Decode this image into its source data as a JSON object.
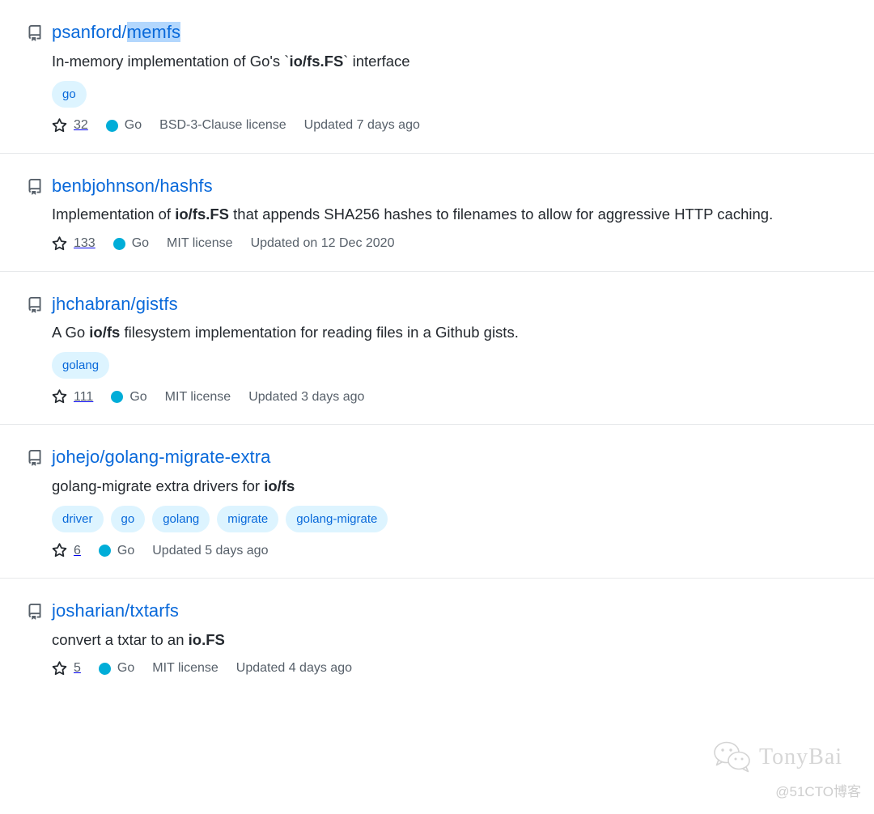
{
  "page": {
    "kind": "github-repository-search-results",
    "result_count_visible": 5
  },
  "icons": {
    "repo": "repo-icon",
    "star": "star-icon",
    "language_dot": "language-color-dot"
  },
  "colors": {
    "link": "#0969da",
    "text": "#24292f",
    "muted": "#57606a",
    "divider": "#e7e9eb",
    "topic_bg": "#ddf4ff",
    "topic_text": "#0969da",
    "go_language": "#00ADD8",
    "selection_highlight": "#b3d7fd"
  },
  "results": [
    {
      "owner": "psanford/",
      "name_highlighted": "memfs",
      "full_name": "psanford/memfs",
      "description_parts": [
        {
          "text": "In-memory implementation of Go's `",
          "bold": false
        },
        {
          "text": "io/fs.FS",
          "bold": true
        },
        {
          "text": "` interface",
          "bold": false
        }
      ],
      "topics": [
        "go"
      ],
      "stars": "32",
      "language": "Go",
      "license": "BSD-3-Clause license",
      "updated": "Updated 7 days ago"
    },
    {
      "owner": "benbjohnson/",
      "name_highlighted": "",
      "full_name": "benbjohnson/hashfs",
      "description_parts": [
        {
          "text": "Implementation of ",
          "bold": false
        },
        {
          "text": "io/fs.FS",
          "bold": true
        },
        {
          "text": " that appends SHA256 hashes to filenames to allow for aggressive HTTP caching.",
          "bold": false
        }
      ],
      "topics": [],
      "stars": "133",
      "language": "Go",
      "license": "MIT license",
      "updated": "Updated on 12 Dec 2020"
    },
    {
      "owner": "jhchabran/",
      "name_highlighted": "",
      "full_name": "jhchabran/gistfs",
      "description_parts": [
        {
          "text": "A Go ",
          "bold": false
        },
        {
          "text": "io/fs",
          "bold": true
        },
        {
          "text": " filesystem implementation for reading files in a Github gists.",
          "bold": false
        }
      ],
      "topics": [
        "golang"
      ],
      "stars": "111",
      "language": "Go",
      "license": "MIT license",
      "updated": "Updated 3 days ago"
    },
    {
      "owner": "johejo/",
      "name_highlighted": "",
      "full_name": "johejo/golang-migrate-extra",
      "description_parts": [
        {
          "text": "golang-migrate extra drivers for ",
          "bold": false
        },
        {
          "text": "io/fs",
          "bold": true
        }
      ],
      "topics": [
        "driver",
        "go",
        "golang",
        "migrate",
        "golang-migrate"
      ],
      "stars": "6",
      "language": "Go",
      "license": "",
      "updated": "Updated 5 days ago"
    },
    {
      "owner": "josharian/",
      "name_highlighted": "",
      "full_name": "josharian/txtarfs",
      "description_parts": [
        {
          "text": "convert a txtar to an ",
          "bold": false
        },
        {
          "text": "io.FS",
          "bold": true
        }
      ],
      "topics": [],
      "stars": "5",
      "language": "Go",
      "license": "MIT license",
      "updated": "Updated 4 days ago"
    }
  ],
  "watermark": {
    "brand": "TonyBai",
    "handle": "@51CTO博客",
    "logo": "wechat-icon"
  }
}
